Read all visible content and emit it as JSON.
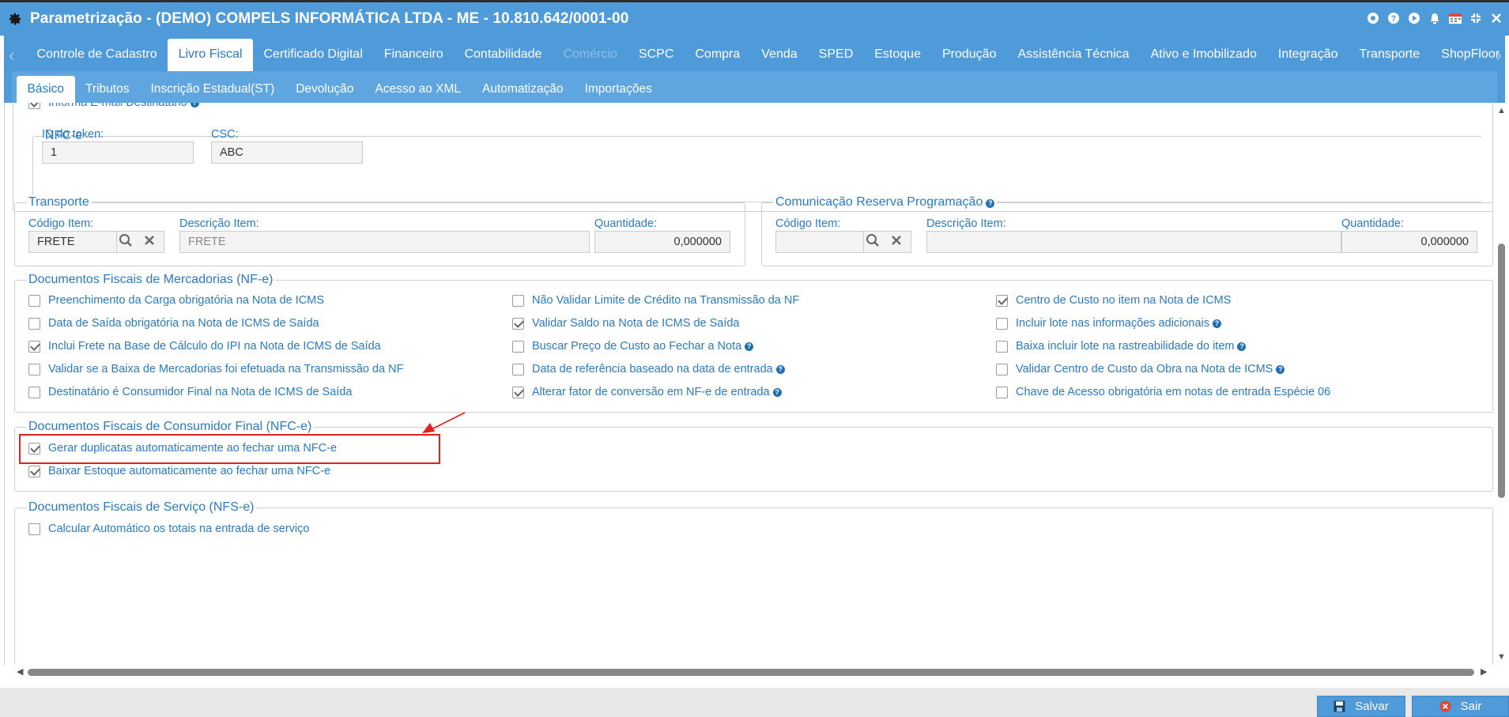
{
  "window": {
    "title": "Parametrização - (DEMO) COMPELS INFORMÁTICA LTDA - ME - 10.810.642/0001-00"
  },
  "main_tabs": [
    {
      "label": "Controle de Cadastro"
    },
    {
      "label": "Livro Fiscal"
    },
    {
      "label": "Certificado Digital"
    },
    {
      "label": "Financeiro"
    },
    {
      "label": "Contabilidade"
    },
    {
      "label": "Comércio"
    },
    {
      "label": "SCPC"
    },
    {
      "label": "Compra"
    },
    {
      "label": "Venda"
    },
    {
      "label": "SPED"
    },
    {
      "label": "Estoque"
    },
    {
      "label": "Produção"
    },
    {
      "label": "Assistência Técnica"
    },
    {
      "label": "Ativo e Imobilizado"
    },
    {
      "label": "Integração"
    },
    {
      "label": "Transporte"
    },
    {
      "label": "ShopFloor"
    }
  ],
  "sub_tabs": [
    {
      "label": "Básico"
    },
    {
      "label": "Tributos"
    },
    {
      "label": "Inscrição Estadual(ST)"
    },
    {
      "label": "Devolução"
    },
    {
      "label": "Acesso ao XML"
    },
    {
      "label": "Automatização"
    },
    {
      "label": "Importações"
    }
  ],
  "partial": {
    "informa_email": "Informa E-mail Destinatário"
  },
  "nfce": {
    "legend": "NFC-e",
    "token_label": "ID do token:",
    "token_value": "1",
    "csc_label": "CSC:",
    "csc_value": "ABC"
  },
  "transporte": {
    "legend": "Transporte",
    "codigo_label": "Código Item:",
    "codigo_value": "FRETE",
    "descricao_label": "Descrição Item:",
    "descricao_value": "FRETE",
    "quantidade_label": "Quantidade:",
    "quantidade_value": "0,000000"
  },
  "reserva": {
    "legend": "Comunicação Reserva Programação",
    "codigo_label": "Código Item:",
    "codigo_value": "",
    "descricao_label": "Descrição Item:",
    "descricao_value": "",
    "quantidade_label": "Quantidade:",
    "quantidade_value": "0,000000"
  },
  "nfe": {
    "legend": "Documentos Fiscais de Mercadorias (NF-e)",
    "col1": [
      {
        "label": "Preenchimento da Carga obrigatória na Nota de ICMS",
        "checked": false
      },
      {
        "label": "Data de Saída obrigatória na Nota de ICMS de Saída",
        "checked": false
      },
      {
        "label": "Inclui Frete na Base de Cálculo do IPI na Nota de ICMS de Saída",
        "checked": true
      },
      {
        "label": "Validar se a Baixa de Mercadorias foi efetuada na Transmissão da NF",
        "checked": false
      },
      {
        "label": "Destinatário é Consumidor Final na Nota de ICMS de Saída",
        "checked": false
      }
    ],
    "col2": [
      {
        "label": "Não Validar Limite de Crédito na Transmissão da NF",
        "checked": false
      },
      {
        "label": "Validar Saldo na Nota de ICMS de Saída",
        "checked": true
      },
      {
        "label": "Buscar Preço de Custo ao Fechar a Nota",
        "checked": false
      },
      {
        "label": "Data de referência baseado na data de entrada",
        "checked": false
      },
      {
        "label": "Alterar fator de conversão em NF-e de entrada",
        "checked": true
      }
    ],
    "col3": [
      {
        "label": "Centro de Custo no item na Nota de ICMS",
        "checked": true
      },
      {
        "label": "Incluir lote nas informações adicionais",
        "checked": false
      },
      {
        "label": "Baixa incluir lote na rastreabilidade do item",
        "checked": false
      },
      {
        "label": "Validar Centro de Custo da Obra na Nota de ICMS",
        "checked": false
      },
      {
        "label": "Chave de Acesso obrigatória em notas de entrada Espécie 06",
        "checked": false
      }
    ]
  },
  "nfce_docs": {
    "legend": "Documentos Fiscais de Consumidor Final (NFC-e)",
    "items": [
      {
        "label": "Gerar duplicatas automaticamente ao fechar uma NFC-e",
        "checked": true
      },
      {
        "label": "Baixar Estoque automaticamente ao fechar uma NFC-e",
        "checked": true
      }
    ]
  },
  "nfse": {
    "legend": "Documentos Fiscais de Serviço (NFS-e)",
    "items": [
      {
        "label": "Calcular Automático os totais na entrada de serviço",
        "checked": false
      }
    ]
  },
  "footer": {
    "save_label": "Salvar",
    "exit_label": "Sair"
  },
  "colors": {
    "accent": "#4f9ad8",
    "text": "#2a7bbf",
    "highlight": "#e0201a"
  }
}
